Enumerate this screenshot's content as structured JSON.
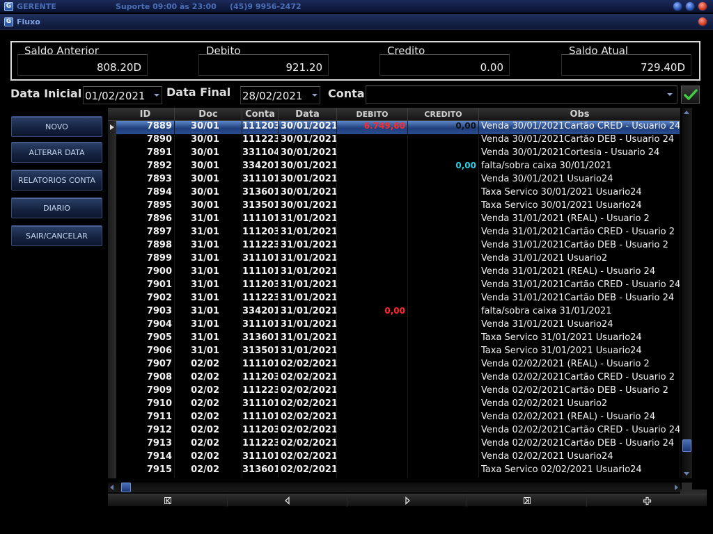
{
  "window": {
    "app_title": "GERENTE",
    "support_hours": "Suporte 09:00 às 23:00",
    "support_phone": "(45)9 9956-2472",
    "form_title": "Fluxo",
    "app_icon_letter": "G"
  },
  "balance": {
    "saldo_anterior_label": "Saldo Anterior",
    "saldo_anterior_value": "808.20D",
    "debito_label": "Debito",
    "debito_value": "921.20",
    "credito_label": "Credito",
    "credito_value": "0.00",
    "saldo_atual_label": "Saldo Atual",
    "saldo_atual_value": "729.40D"
  },
  "filters": {
    "data_inicial_label": "Data Inicial",
    "data_inicial_value": "01/02/2021",
    "data_final_label": "Data Final",
    "data_final_value": "28/02/2021",
    "conta_label": "Conta",
    "conta_value": ""
  },
  "actions": {
    "novo": "NOVO",
    "alterar_data": "ALTERAR DATA",
    "relatorios_conta": "RELATORIOS CONTA",
    "diario": "DIARIO",
    "sair_cancelar": "SAIR/CANCELAR"
  },
  "grid": {
    "columns": [
      "ID",
      "Doc",
      "Conta",
      "Data",
      "DEBITO",
      "CREDITO",
      "Obs"
    ],
    "rows": [
      {
        "id": "7889",
        "doc": "30/01",
        "conta": "111203",
        "data": "30/01/2021",
        "debito": "6.749,60",
        "credito": "0,00",
        "obs": "Venda 30/01/2021Cartão CRED - Usuario 24"
      },
      {
        "id": "7890",
        "doc": "30/01",
        "conta": "111223",
        "data": "30/01/2021",
        "debito": "",
        "credito": "",
        "obs": "Venda 30/01/2021Cartão DEB - Usuario 24"
      },
      {
        "id": "7891",
        "doc": "30/01",
        "conta": "331104",
        "data": "30/01/2021",
        "debito": "",
        "credito": "",
        "obs": "Venda 30/01/2021Cortesia - Usuario 24"
      },
      {
        "id": "7892",
        "doc": "30/01",
        "conta": "334201",
        "data": "30/01/2021",
        "debito": "",
        "credito": "0,00",
        "obs": "falta/sobra caixa 30/01/2021"
      },
      {
        "id": "7893",
        "doc": "30/01",
        "conta": "311101",
        "data": "30/01/2021",
        "debito": "",
        "credito": "",
        "obs": "Venda 30/01/2021 Usuario24"
      },
      {
        "id": "7894",
        "doc": "30/01",
        "conta": "313601",
        "data": "30/01/2021",
        "debito": "",
        "credito": "",
        "obs": "Taxa Servico 30/01/2021 Usuario24"
      },
      {
        "id": "7895",
        "doc": "30/01",
        "conta": "313501",
        "data": "30/01/2021",
        "debito": "",
        "credito": "",
        "obs": "Taxa Servico 30/01/2021 Usuario24"
      },
      {
        "id": "7896",
        "doc": "31/01",
        "conta": "111101",
        "data": "31/01/2021",
        "debito": "",
        "credito": "",
        "obs": "Venda 31/01/2021 (REAL) - Usuario 2"
      },
      {
        "id": "7897",
        "doc": "31/01",
        "conta": "111203",
        "data": "31/01/2021",
        "debito": "",
        "credito": "",
        "obs": "Venda 31/01/2021Cartão CRED - Usuario 2"
      },
      {
        "id": "7898",
        "doc": "31/01",
        "conta": "111223",
        "data": "31/01/2021",
        "debito": "",
        "credito": "",
        "obs": "Venda 31/01/2021Cartão DEB - Usuario 2"
      },
      {
        "id": "7899",
        "doc": "31/01",
        "conta": "311101",
        "data": "31/01/2021",
        "debito": "",
        "credito": "",
        "obs": "Venda 31/01/2021 Usuario2"
      },
      {
        "id": "7900",
        "doc": "31/01",
        "conta": "111101",
        "data": "31/01/2021",
        "debito": "",
        "credito": "",
        "obs": "Venda 31/01/2021 (REAL) - Usuario 24"
      },
      {
        "id": "7901",
        "doc": "31/01",
        "conta": "111203",
        "data": "31/01/2021",
        "debito": "",
        "credito": "",
        "obs": "Venda 31/01/2021Cartão CRED - Usuario 24"
      },
      {
        "id": "7902",
        "doc": "31/01",
        "conta": "111223",
        "data": "31/01/2021",
        "debito": "",
        "credito": "",
        "obs": "Venda 31/01/2021Cartão DEB - Usuario 24"
      },
      {
        "id": "7903",
        "doc": "31/01",
        "conta": "334201",
        "data": "31/01/2021",
        "debito": "0,00",
        "credito": "",
        "obs": "falta/sobra caixa 31/01/2021"
      },
      {
        "id": "7904",
        "doc": "31/01",
        "conta": "311101",
        "data": "31/01/2021",
        "debito": "",
        "credito": "",
        "obs": "Venda 31/01/2021 Usuario24"
      },
      {
        "id": "7905",
        "doc": "31/01",
        "conta": "313601",
        "data": "31/01/2021",
        "debito": "",
        "credito": "",
        "obs": "Taxa Servico 31/01/2021 Usuario24"
      },
      {
        "id": "7906",
        "doc": "31/01",
        "conta": "313501",
        "data": "31/01/2021",
        "debito": "",
        "credito": "",
        "obs": "Taxa Servico 31/01/2021 Usuario24"
      },
      {
        "id": "7907",
        "doc": "02/02",
        "conta": "111101",
        "data": "02/02/2021",
        "debito": "",
        "credito": "",
        "obs": "Venda 02/02/2021 (REAL) - Usuario 2"
      },
      {
        "id": "7908",
        "doc": "02/02",
        "conta": "111203",
        "data": "02/02/2021",
        "debito": "",
        "credito": "",
        "obs": "Venda 02/02/2021Cartão CRED - Usuario 2"
      },
      {
        "id": "7909",
        "doc": "02/02",
        "conta": "111223",
        "data": "02/02/2021",
        "debito": "",
        "credito": "",
        "obs": "Venda 02/02/2021Cartão DEB - Usuario 2"
      },
      {
        "id": "7910",
        "doc": "02/02",
        "conta": "311101",
        "data": "02/02/2021",
        "debito": "",
        "credito": "",
        "obs": "Venda 02/02/2021 Usuario2"
      },
      {
        "id": "7911",
        "doc": "02/02",
        "conta": "111101",
        "data": "02/02/2021",
        "debito": "",
        "credito": "",
        "obs": "Venda 02/02/2021 (REAL) - Usuario 24"
      },
      {
        "id": "7912",
        "doc": "02/02",
        "conta": "111203",
        "data": "02/02/2021",
        "debito": "",
        "credito": "",
        "obs": "Venda 02/02/2021Cartão CRED - Usuario 24"
      },
      {
        "id": "7913",
        "doc": "02/02",
        "conta": "111223",
        "data": "02/02/2021",
        "debito": "",
        "credito": "",
        "obs": "Venda 02/02/2021Cartão DEB - Usuario 24"
      },
      {
        "id": "7914",
        "doc": "02/02",
        "conta": "311101",
        "data": "02/02/2021",
        "debito": "",
        "credito": "",
        "obs": "Venda 02/02/2021 Usuario24"
      },
      {
        "id": "7915",
        "doc": "02/02",
        "conta": "313601",
        "data": "02/02/2021",
        "debito": "",
        "credito": "",
        "obs": "Taxa Servico 02/02/2021 Usuario24"
      }
    ]
  },
  "icons": {
    "confirm": "checkmark-icon",
    "nav_first": "first-record-icon",
    "nav_prior": "prior-record-icon",
    "nav_next": "next-record-icon",
    "nav_last": "last-record-icon",
    "nav_insert": "insert-record-icon"
  },
  "colors": {
    "debit_text": "#ff2a2a",
    "credit_text": "#2ad0e8",
    "selection": "#2a4d90",
    "confirm_check": "#3fcf3f"
  }
}
